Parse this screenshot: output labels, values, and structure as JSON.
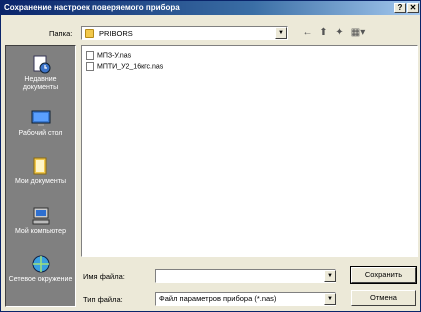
{
  "window": {
    "title": "Сохранение настроек поверяемого прибора",
    "help_label": "?",
    "close_label": "✕"
  },
  "folder": {
    "label": "Папка:",
    "value": "PRIBORS",
    "icon": "folder-icon"
  },
  "toolbar": {
    "back_icon": "←",
    "up_icon": "⬆",
    "new_folder_icon": "✦",
    "view_icon": "▦▾"
  },
  "places": [
    {
      "label": "Недавние документы",
      "icon": "recent-documents-icon"
    },
    {
      "label": "Рабочий стол",
      "icon": "desktop-icon"
    },
    {
      "label": "Мои документы",
      "icon": "my-documents-icon"
    },
    {
      "label": "Мой компьютер",
      "icon": "my-computer-icon"
    },
    {
      "label": "Сетевое окружение",
      "icon": "network-icon"
    }
  ],
  "files": [
    {
      "name": "МПЗ-У.nas"
    },
    {
      "name": "МПТИ_У2_16кгс.nas"
    }
  ],
  "filename": {
    "label": "Имя файла:",
    "value": ""
  },
  "filetype": {
    "label": "Тип файла:",
    "value": "Файл параметров прибора (*.nas)"
  },
  "buttons": {
    "save": "Сохранить",
    "cancel": "Отмена"
  }
}
